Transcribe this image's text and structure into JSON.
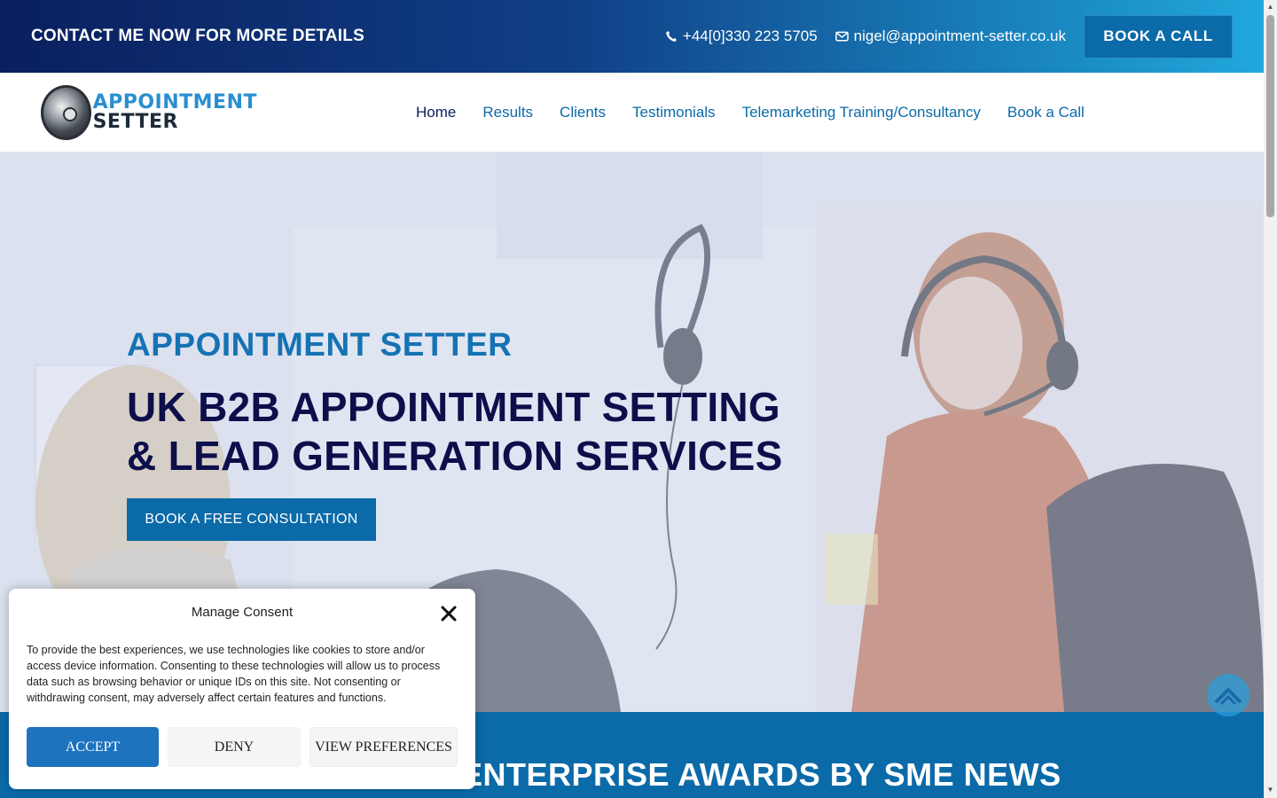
{
  "topbar": {
    "tagline": "CONTACT ME NOW FOR MORE DETAILS",
    "phone": "+44[0]330 223 5705",
    "email": "nigel@appointment-setter.co.uk",
    "book_button": "BOOK A CALL",
    "phone_icon": "phone-icon",
    "email_icon": "envelope-icon"
  },
  "logo": {
    "line1": "APPOINTMENT",
    "line2": "SETTER"
  },
  "nav": {
    "items": [
      {
        "label": "Home",
        "active": true
      },
      {
        "label": "Results"
      },
      {
        "label": "Clients"
      },
      {
        "label": "Testimonials"
      },
      {
        "label": "Telemarketing Training/Consultancy"
      },
      {
        "label": "Book a Call"
      }
    ]
  },
  "hero": {
    "kicker": "APPOINTMENT SETTER",
    "headline_line1": "UK B2B APPOINTMENT SETTING",
    "headline_line2": "& LEAD GENERATION SERVICES",
    "cta": "BOOK A FREE CONSULTATION"
  },
  "strip": {
    "title": "ENTERPRISE AWARDS BY SME NEWS"
  },
  "consent": {
    "title": "Manage Consent",
    "text": "To provide the best experiences, we use technologies like cookies to store and/or access device information. Consenting to these technologies will allow us to process data such as browsing behavior or unique IDs on this site. Not consenting or withdrawing consent, may adversely affect certain features and functions.",
    "accept": "ACCEPT",
    "deny": "DENY",
    "preferences": "VIEW PREFERENCES"
  },
  "colors": {
    "brand_dark": "#0a1f5e",
    "brand_blue": "#0b6aa8",
    "accent": "#1e73be",
    "headline": "#0c0f4a"
  }
}
